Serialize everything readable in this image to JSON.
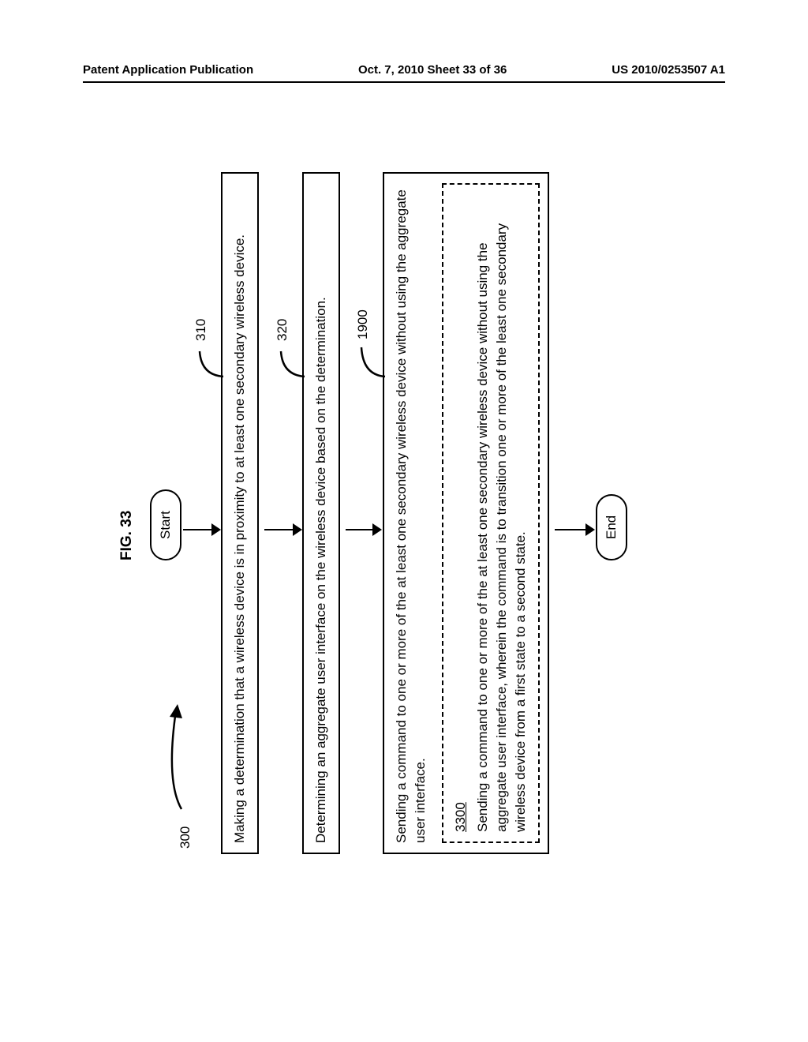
{
  "header": {
    "left": "Patent Application Publication",
    "center": "Oct. 7, 2010   Sheet 33 of 36",
    "right": "US 2010/0253507 A1"
  },
  "figure": {
    "title": "FIG. 33",
    "main_ref": "300",
    "start_label": "Start",
    "end_label": "End",
    "steps": {
      "s310": {
        "ref": "310",
        "text": "Making a determination that a wireless device is in proximity to at least one secondary wireless device."
      },
      "s320": {
        "ref": "320",
        "text": "Determining an aggregate user interface on the wireless device based on the determination."
      },
      "s1900": {
        "ref": "1900",
        "text": "Sending a command to one or more of the at least one secondary wireless device without using the aggregate user interface."
      },
      "s3300": {
        "ref": "3300",
        "text": "Sending a command to one or more of the at least one secondary wireless device without using the aggregate user interface, wherein the command is to transition one or more of the least one secondary wireless device from a first state to a second state."
      }
    }
  }
}
